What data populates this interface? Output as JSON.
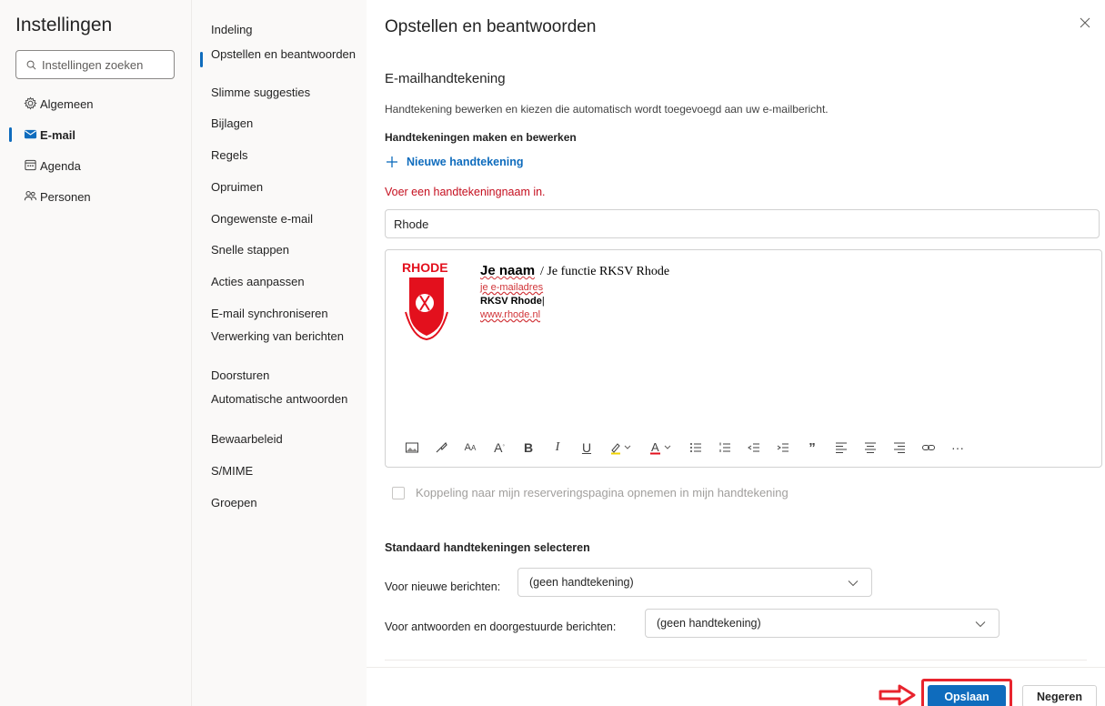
{
  "app": {
    "title": "Instellingen"
  },
  "search": {
    "placeholder": "Instellingen zoeken"
  },
  "leftnav": {
    "items": [
      {
        "label": "Algemeen",
        "icon": "gear-icon"
      },
      {
        "label": "E-mail",
        "icon": "mail-icon",
        "active": true
      },
      {
        "label": "Agenda",
        "icon": "calendar-icon"
      },
      {
        "label": "Personen",
        "icon": "people-icon"
      }
    ]
  },
  "midnav": {
    "items": [
      {
        "label": "Indeling"
      },
      {
        "label": "Opstellen en beantwoorden",
        "active": true
      },
      {
        "label": "Slimme suggesties"
      },
      {
        "label": "Bijlagen"
      },
      {
        "label": "Regels"
      },
      {
        "label": "Opruimen"
      },
      {
        "label": "Ongewenste e-mail"
      },
      {
        "label": "Snelle stappen"
      },
      {
        "label": "Acties aanpassen"
      },
      {
        "label": "E-mail synchroniseren"
      },
      {
        "label": "Verwerking van berichten"
      },
      {
        "label": "Doorsturen"
      },
      {
        "label": "Automatische antwoorden"
      },
      {
        "label": "Bewaarbeleid"
      },
      {
        "label": "S/MIME"
      },
      {
        "label": "Groepen"
      }
    ]
  },
  "main": {
    "title": "Opstellen en beantwoorden",
    "section_title": "E-mailhandtekening",
    "description": "Handtekening bewerken en kiezen die automatisch wordt toegevoegd aan uw e-mailbericht.",
    "subsection": "Handtekeningen maken en bewerken",
    "new_signature": "Nieuwe handtekening",
    "error": "Voer een handtekeningnaam in.",
    "name_value": "Rhode",
    "signature": {
      "logo_text": "RHODE",
      "name": "Je naam",
      "role": "/ Je functie RKSV Rhode",
      "email": "je e-mailadres",
      "club": "RKSV Rhode",
      "url": "www.rhode.nl"
    },
    "booking_label": "Koppeling naar mijn reserveringspagina opnemen in mijn handtekening",
    "defaults_title": "Standaard handtekeningen selecteren",
    "new_messages_label": "Voor nieuwe berichten:",
    "new_messages_value": "(geen handtekening)",
    "replies_label": "Voor antwoorden en doorgestuurde berichten:",
    "replies_value": "(geen handtekening)"
  },
  "footer": {
    "save": "Opslaan",
    "cancel": "Negeren"
  },
  "colors": {
    "accent": "#0f6cbd",
    "error": "#c50f1f",
    "highlight": "#e8242e"
  }
}
